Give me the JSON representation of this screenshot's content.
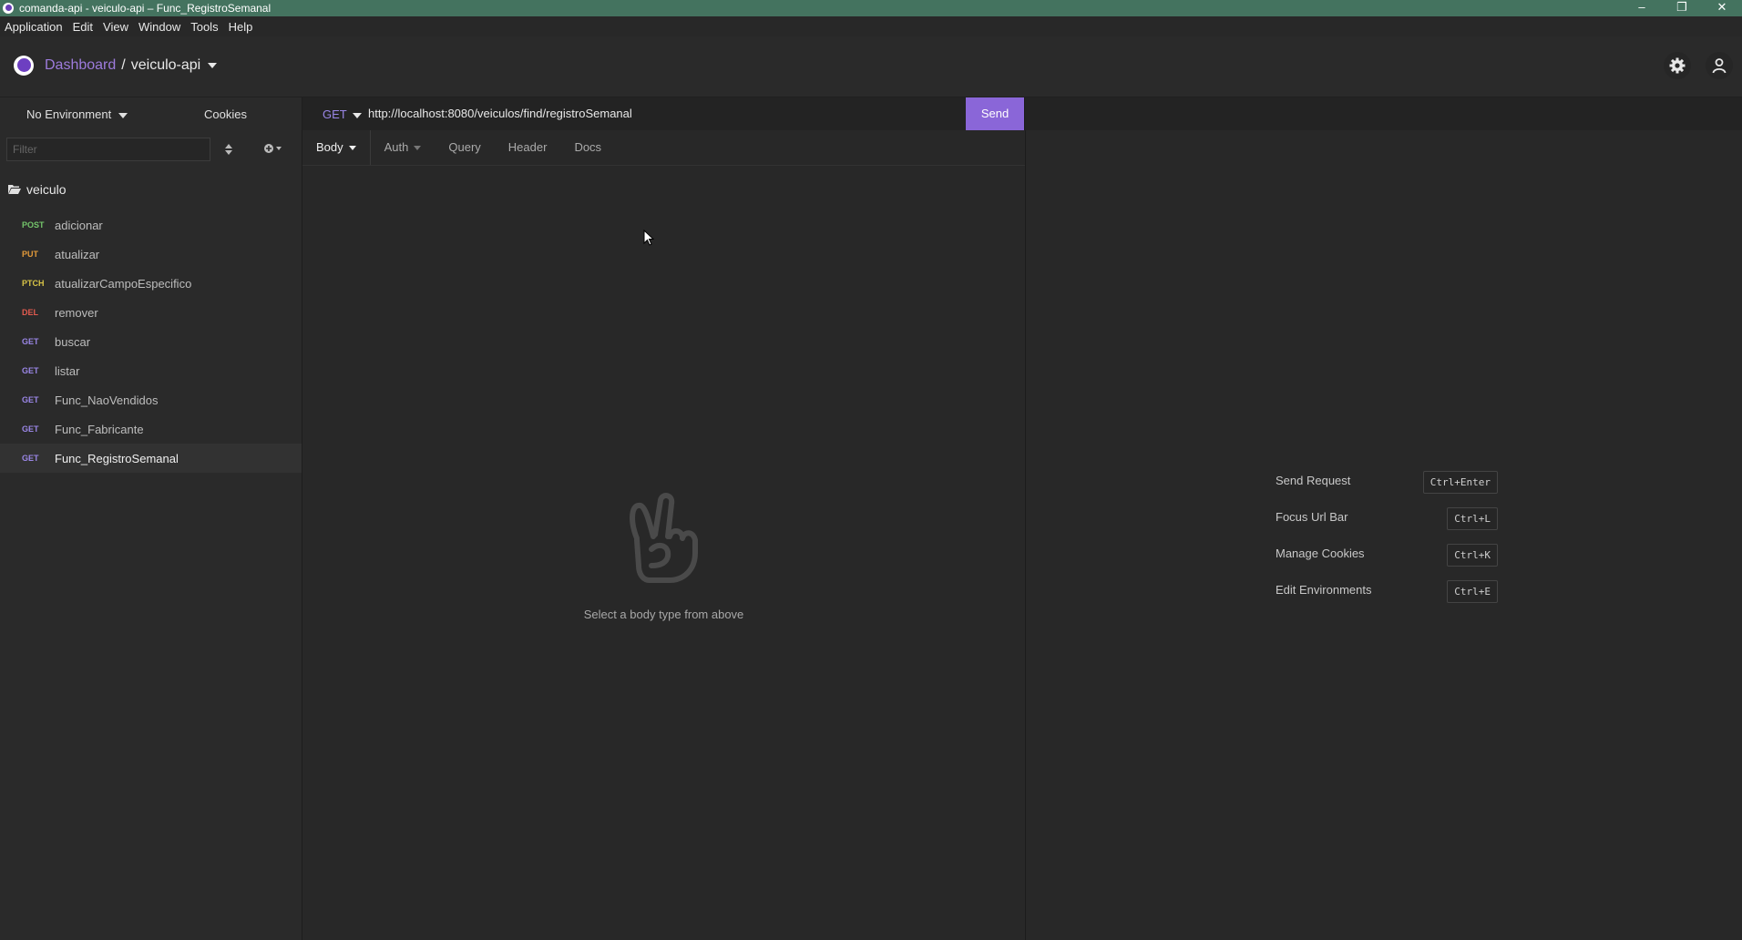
{
  "window": {
    "title": "comanda-api - veiculo-api – Func_RegistroSemanal",
    "controls": {
      "minimize": "–",
      "restore": "❐",
      "close": "✕"
    }
  },
  "menu": [
    "Application",
    "Edit",
    "View",
    "Window",
    "Tools",
    "Help"
  ],
  "header": {
    "dashboard": "Dashboard",
    "separator": "/",
    "project": "veiculo-api",
    "icons": [
      "settings-icon",
      "account-icon"
    ]
  },
  "sidebar": {
    "environment": "No Environment",
    "cookies": "Cookies",
    "filter_placeholder": "Filter",
    "folder": "veiculo",
    "requests": [
      {
        "method": "POST",
        "name": "adicionar"
      },
      {
        "method": "PUT",
        "name": "atualizar"
      },
      {
        "method": "PTCH",
        "name": "atualizarCampoEspecifico"
      },
      {
        "method": "DEL",
        "name": "remover"
      },
      {
        "method": "GET",
        "name": "buscar"
      },
      {
        "method": "GET",
        "name": "listar"
      },
      {
        "method": "GET",
        "name": "Func_NaoVendidos"
      },
      {
        "method": "GET",
        "name": "Func_Fabricante"
      },
      {
        "method": "GET",
        "name": "Func_RegistroSemanal",
        "active": true
      }
    ]
  },
  "request": {
    "method": "GET",
    "url": "http://localhost:8080/veiculos/find/registroSemanal",
    "send_label": "Send",
    "tabs": [
      "Body",
      "Auth",
      "Query",
      "Header",
      "Docs"
    ],
    "empty_message": "Select a body type from above"
  },
  "shortcuts": [
    {
      "label": "Send Request",
      "key": "Ctrl+Enter"
    },
    {
      "label": "Focus Url Bar",
      "key": "Ctrl+L"
    },
    {
      "label": "Manage Cookies",
      "key": "Ctrl+K"
    },
    {
      "label": "Edit Environments",
      "key": "Ctrl+E"
    }
  ],
  "colors": {
    "titlebar": "#44735f",
    "accent": "#8a66d8",
    "post": "#74c56b",
    "put": "#e39a3a",
    "patch": "#d8c447",
    "delete": "#e25a4f",
    "get": "#9a86e6"
  }
}
